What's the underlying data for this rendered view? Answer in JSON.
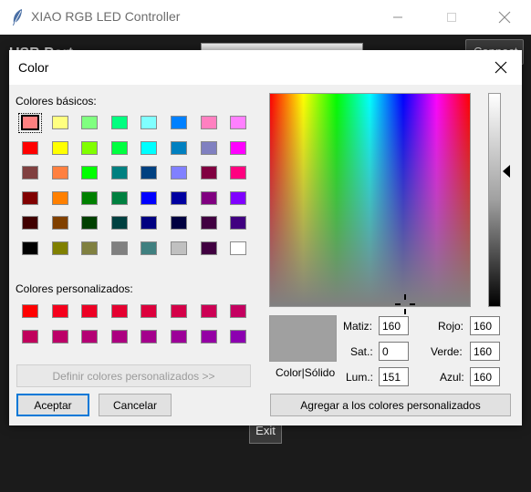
{
  "app": {
    "title": "XIAO RGB LED Controller",
    "partial_label": "USB Port",
    "partial_button": "Connect",
    "exit_label": "Exit"
  },
  "dialog": {
    "title": "Color",
    "basic_label": "Colores básicos:",
    "custom_label": "Colores personalizados:",
    "define_button": "Definir colores personalizados >>",
    "ok_button": "Aceptar",
    "cancel_button": "Cancelar",
    "add_button": "Agregar a los colores personalizados",
    "preview_label": "Color|Sólido",
    "fields": {
      "hue_label": "Matiz:",
      "hue": "160",
      "sat_label": "Sat.:",
      "sat": "0",
      "lum_label": "Lum.:",
      "lum": "151",
      "red_label": "Rojo:",
      "red": "160",
      "green_label": "Verde:",
      "green": "160",
      "blue_label": "Azul:",
      "blue": "160"
    },
    "basic_colors": [
      [
        "#ff8080",
        "#ffff80",
        "#80ff80",
        "#00ff80",
        "#80ffff",
        "#0080ff",
        "#ff80c0",
        "#ff80ff"
      ],
      [
        "#ff0000",
        "#ffff00",
        "#80ff00",
        "#00ff40",
        "#00ffff",
        "#0080c0",
        "#8080c0",
        "#ff00ff"
      ],
      [
        "#804040",
        "#ff8040",
        "#00ff00",
        "#008080",
        "#004080",
        "#8080ff",
        "#800040",
        "#ff0080"
      ],
      [
        "#800000",
        "#ff8000",
        "#008000",
        "#008040",
        "#0000ff",
        "#0000a0",
        "#800080",
        "#8000ff"
      ],
      [
        "#400000",
        "#804000",
        "#004000",
        "#004040",
        "#000080",
        "#000040",
        "#400040",
        "#400080"
      ],
      [
        "#000000",
        "#808000",
        "#808040",
        "#808080",
        "#408080",
        "#c0c0c0",
        "#400040",
        "#ffffff"
      ]
    ],
    "custom_colors": [
      [
        "#ff0000",
        "#f5001c",
        "#ed0024",
        "#e50030",
        "#dc003c",
        "#d40048",
        "#cc0054",
        "#c40060"
      ],
      [
        "#c0005c",
        "#bc0068",
        "#b40074",
        "#ac0080",
        "#a4008c",
        "#9c0098",
        "#9400a4",
        "#8c00b0"
      ]
    ],
    "selected_color": "#a0a0a0"
  }
}
